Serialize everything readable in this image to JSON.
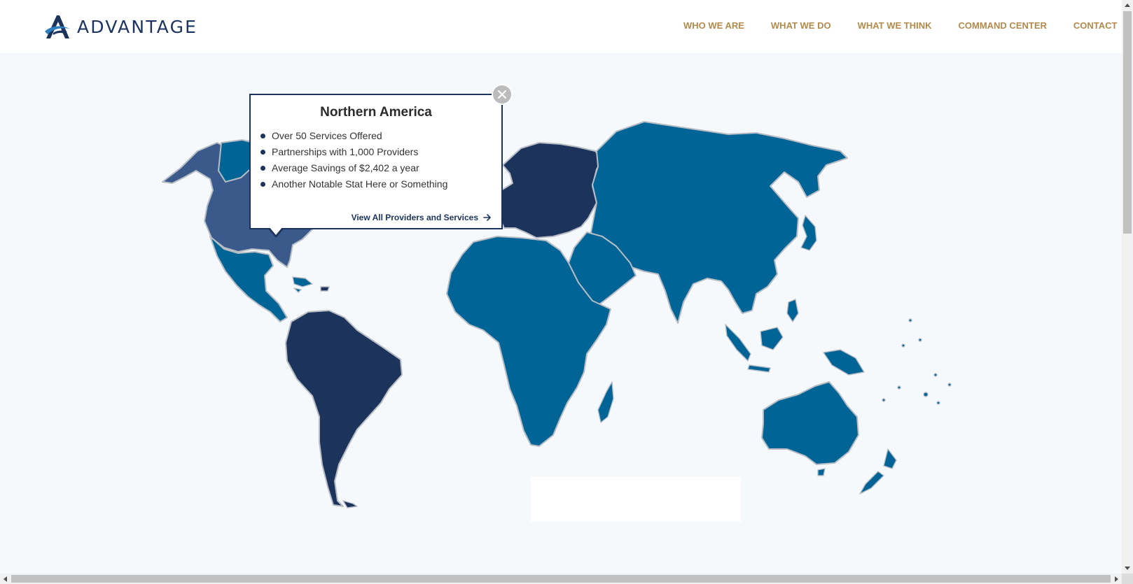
{
  "brand": {
    "name": "ADVANTAGE",
    "logo_icon": "stylized-a-logo-icon",
    "primary_color": "#1c335c",
    "accent_color": "#b38a4a"
  },
  "nav": {
    "items": [
      {
        "label": "WHO WE ARE"
      },
      {
        "label": "WHAT WE DO"
      },
      {
        "label": "WHAT WE THINK"
      },
      {
        "label": "COMMAND CENTER"
      },
      {
        "label": "CONTACT"
      }
    ]
  },
  "map": {
    "region_colors": {
      "selected_region": "#3a5a8c",
      "standard_region": "#006496",
      "dark_region": "#1c335c",
      "background": "#f5f9fc"
    }
  },
  "popup": {
    "title": "Northern America",
    "stats": [
      "Over 50 Services Offered",
      "Partnerships with 1,000 Providers",
      "Average Savings of $2,402 a year",
      "Another Notable Stat Here or Something"
    ],
    "link_label": "View All Providers and Services",
    "link_icon": "arrow-right-icon",
    "close_icon": "close-icon"
  }
}
